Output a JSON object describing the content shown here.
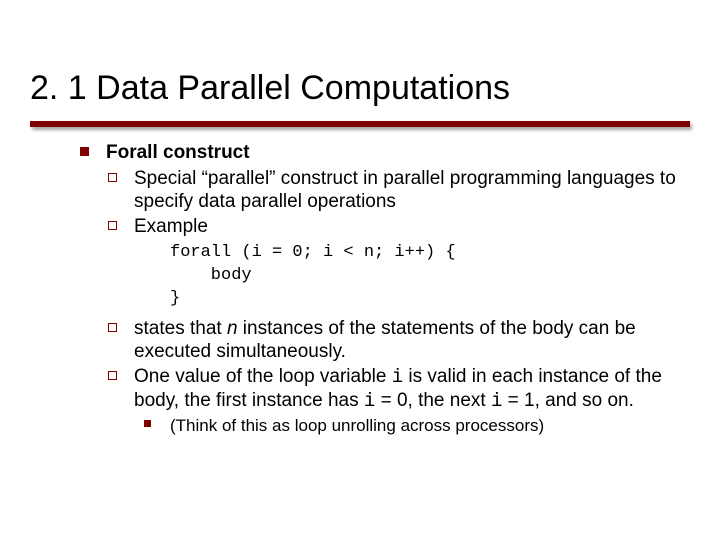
{
  "title": "2. 1 Data Parallel Computations",
  "l1": {
    "heading": "Forall construct",
    "sub1": "Special “parallel” construct in parallel programming languages to specify data parallel operations",
    "sub2": "Example",
    "code_l1": "forall (i = 0; i < n; i++) {",
    "code_l2": "    body",
    "code_l3": "}",
    "sub3_pre": "states that ",
    "sub3_n": "n",
    "sub3_post": " instances of the statements of the body can be executed simultaneously.",
    "sub4_a": "One value of the loop variable ",
    "sub4_i1": "i",
    "sub4_b": " is valid in each instance of the body, the first instance has ",
    "sub4_i2": "i",
    "sub4_c": " = 0, the next ",
    "sub4_i3": "i",
    "sub4_d": " = 1, and so on.",
    "note": "(Think of this as loop unrolling across processors)"
  }
}
